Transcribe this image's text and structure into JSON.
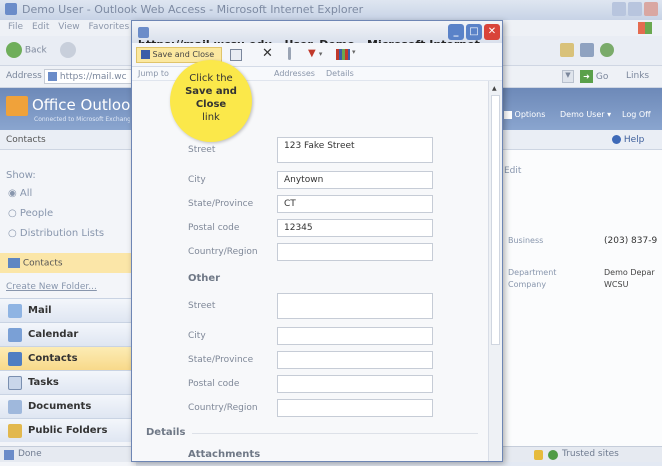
{
  "background_browser": {
    "title": "Demo User - Outlook Web Access - Microsoft Internet Explorer",
    "menu": [
      "File",
      "Edit",
      "View",
      "Favorites"
    ],
    "back_label": "Back",
    "address_label": "Address",
    "address_value": "https://mail.wc",
    "go_label": "Go",
    "links_label": "Links",
    "status_text": "Done",
    "zone_text": "Trusted sites"
  },
  "owa": {
    "brand": "Office Outlook",
    "brand_sub": "Connected to Microsoft Exchange",
    "options_label": "Options",
    "user_label": "Demo User",
    "logoff_label": "Log Off",
    "folder_title": "Contacts",
    "help_label": "Help",
    "show_label": "Show:",
    "filters": [
      "All",
      "People",
      "Distribution Lists"
    ],
    "current_folder": "Contacts",
    "create_folder": "Create New Folder...",
    "nav": [
      {
        "label": "Mail",
        "icon": "mail-icon"
      },
      {
        "label": "Calendar",
        "icon": "calendar-icon"
      },
      {
        "label": "Contacts",
        "icon": "contacts-icon"
      },
      {
        "label": "Tasks",
        "icon": "tasks-icon"
      },
      {
        "label": "Documents",
        "icon": "documents-icon"
      },
      {
        "label": "Public Folders",
        "icon": "public-folders-icon"
      }
    ],
    "right_edit": "Edit",
    "right_rows": [
      {
        "label": "Business",
        "value": "(203) 837-9"
      },
      {
        "label": "Department",
        "value": "Demo Depar"
      },
      {
        "label": "Company",
        "value": "WCSU"
      }
    ]
  },
  "popup": {
    "title": "https://mail.wcsu.edu - User, Demo - Microsoft Internet ...",
    "save_close_label": "Save and Close",
    "jump_label": "Jump to",
    "addresses_link": "Addresses",
    "details_link": "Details",
    "business_fields": [
      {
        "label": "Street",
        "value": "123 Fake Street"
      },
      {
        "label": "City",
        "value": "Anytown"
      },
      {
        "label": "State/Province",
        "value": "CT"
      },
      {
        "label": "Postal code",
        "value": "12345"
      },
      {
        "label": "Country/Region",
        "value": ""
      }
    ],
    "other_heading": "Other",
    "other_fields": [
      {
        "label": "Street",
        "value": ""
      },
      {
        "label": "City",
        "value": ""
      },
      {
        "label": "State/Province",
        "value": ""
      },
      {
        "label": "Postal code",
        "value": ""
      },
      {
        "label": "Country/Region",
        "value": ""
      }
    ],
    "details_heading": "Details",
    "attachments_heading": "Attachments"
  },
  "callout": {
    "line1": "Click the",
    "bold": "Save and Close",
    "line3": "link"
  },
  "colors": {
    "callout": "#fbe84a",
    "owa_header": "#6d89b8",
    "selected_nav": "#f8d98a",
    "close_button": "#d9443a"
  }
}
